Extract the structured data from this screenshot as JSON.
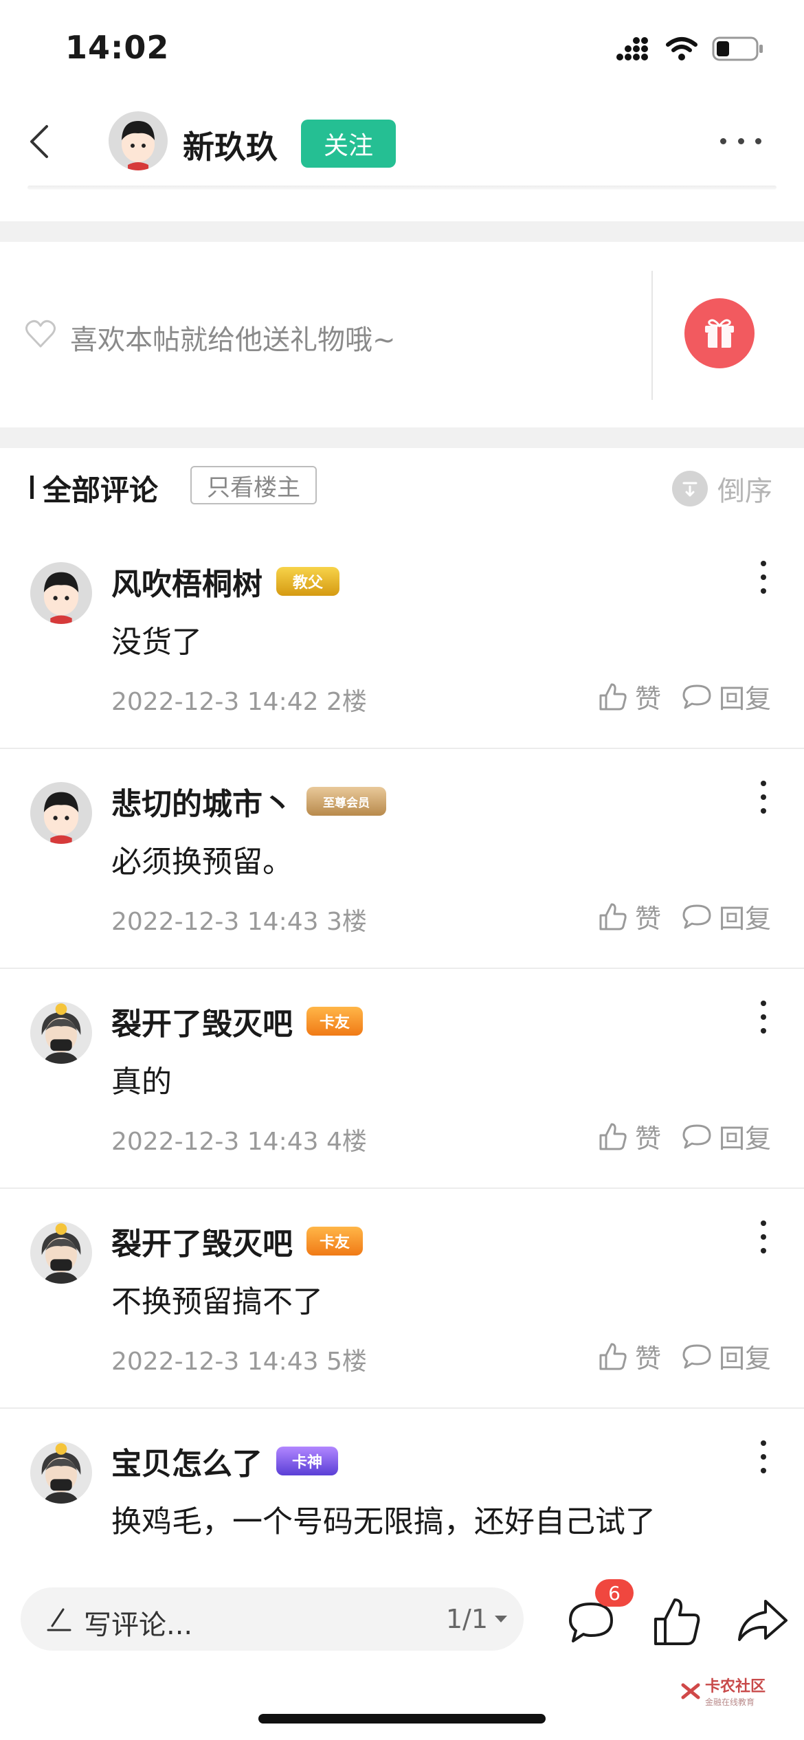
{
  "status": {
    "time": "14:02"
  },
  "nav": {
    "author_name": "新玖玖",
    "follow_label": "关注"
  },
  "gift": {
    "prompt": "喜欢本帖就给他送礼物哦~"
  },
  "comments_header": {
    "title": "全部评论",
    "filter_label": "只看楼主",
    "sort_label": "倒序"
  },
  "comments": [
    {
      "name": "风吹梧桐树",
      "badge": "教父",
      "text": "没货了",
      "time": "2022-12-3 14:42",
      "floor": "2楼",
      "like_label": "赞",
      "reply_label": "回复"
    },
    {
      "name": "悲切的城市丶",
      "badge": "至尊会员",
      "text": "必须换预留。",
      "time": "2022-12-3 14:43",
      "floor": "3楼",
      "like_label": "赞",
      "reply_label": "回复"
    },
    {
      "name": "裂开了毁灭吧",
      "badge": "卡友",
      "text": "真的",
      "time": "2022-12-3 14:43",
      "floor": "4楼",
      "like_label": "赞",
      "reply_label": "回复"
    },
    {
      "name": "裂开了毁灭吧",
      "badge": "卡友",
      "text": "不换预留搞不了",
      "time": "2022-12-3 14:43",
      "floor": "5楼",
      "like_label": "赞",
      "reply_label": "回复"
    },
    {
      "name": "宝贝怎么了",
      "badge": "卡神",
      "text": "换鸡毛，一个号码无限搞，还好自己试了",
      "time": "",
      "floor": "",
      "like_label": "",
      "reply_label": ""
    }
  ],
  "bottom": {
    "write_placeholder": "写评论...",
    "page_indicator": "1/1",
    "comment_count": "6"
  },
  "watermark": {
    "main": "卡农社区",
    "sub": "金融在线教育"
  },
  "colors": {
    "accent_green": "#25bf93",
    "gift_red": "#f25a5f",
    "badge_red": "#f0473f",
    "muted_text": "#9a9a9a"
  }
}
